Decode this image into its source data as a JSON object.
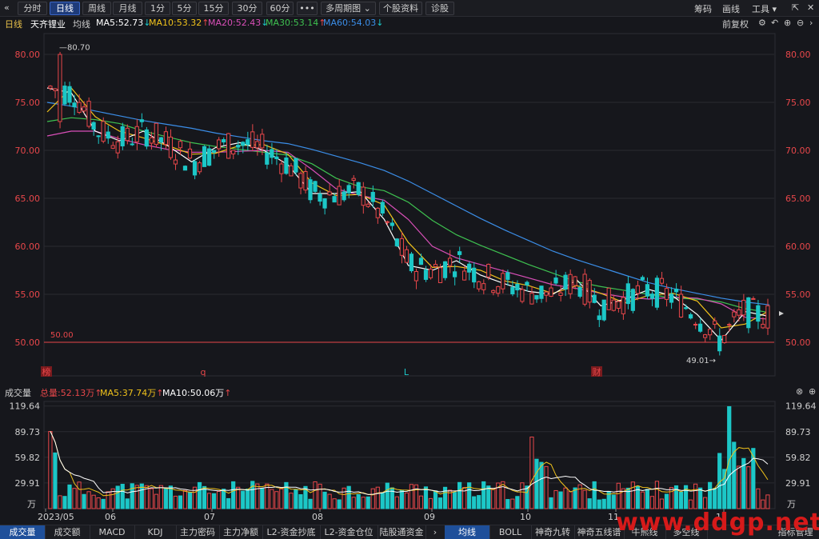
{
  "toolbar": {
    "collapse_icon": "double-chevron-left",
    "tabs": [
      "分时",
      "日线",
      "周线",
      "月线",
      "1分",
      "5分",
      "15分",
      "30分",
      "60分",
      "•••",
      "多周期图 ⌄",
      "个股资料",
      "诊股"
    ],
    "active_tab": "日线",
    "right_items": [
      "筹码",
      "画线",
      "工具 ▾"
    ],
    "window_icons": [
      "pin-icon",
      "close-icon"
    ]
  },
  "ma_bar": {
    "period": "日线",
    "stock_name": "天齐锂业",
    "line_type": "均线",
    "ma5": "MA5:52.73",
    "ma10": "MA10:53.32",
    "ma20": "MA20:52.43",
    "ma30": "MA30:53.14",
    "ma60": "MA60:54.03",
    "adjust": "前复权"
  },
  "colors": {
    "up": "#e8474a",
    "down": "#1cc7c7",
    "ma5": "#ffffff",
    "ma10": "#f0c21b",
    "ma20": "#d94fb8",
    "ma30": "#3ec150",
    "ma60": "#3b8ee8",
    "price_axis": "#e8474a"
  },
  "chart_data": {
    "type": "candlestick",
    "y_ticks": [
      "80.00",
      "75.00",
      "70.00",
      "65.00",
      "60.00",
      "55.00",
      "50.00"
    ],
    "ylim": [
      46.5,
      81.5
    ],
    "high_label": "80.70",
    "low_label": "49.01→",
    "ref_line_label": "50.00",
    "ref_line_value": 50.0,
    "event_markers": [
      "榜",
      "q",
      "L",
      "财"
    ],
    "x_labels": [
      "2023/05",
      "06",
      "07",
      "08",
      "09",
      "10",
      "11",
      "12"
    ],
    "ma60": [
      75.0,
      74.6,
      74.1,
      73.6,
      73.1,
      72.7,
      72.3,
      71.8,
      71.4,
      71.0,
      70.7,
      70.1,
      69.4,
      68.7,
      67.9,
      66.8,
      65.5,
      64.2,
      62.9,
      61.7,
      60.6,
      59.5,
      58.6,
      57.8,
      57.0,
      56.2,
      55.6,
      55.1,
      54.6,
      54.2,
      53.9
    ],
    "ma30": [
      73.0,
      73.4,
      73.2,
      72.8,
      72.0,
      71.4,
      70.8,
      70.4,
      70.1,
      69.8,
      69.5,
      68.6,
      67.1,
      66.2,
      65.8,
      64.6,
      62.7,
      61.2,
      60.1,
      59.1,
      58.1,
      57.2,
      56.3,
      55.8,
      55.4,
      55.0,
      54.6,
      54.5,
      54.2,
      53.5,
      53.1
    ],
    "ma20": [
      71.5,
      72.0,
      72.0,
      71.2,
      70.6,
      70.1,
      69.8,
      69.8,
      69.9,
      70.0,
      69.8,
      68.0,
      66.0,
      65.3,
      64.8,
      62.8,
      60.0,
      58.8,
      58.1,
      57.4,
      56.7,
      56.0,
      55.6,
      55.1,
      54.7,
      54.5,
      54.7,
      54.6,
      54.0,
      52.6,
      52.4
    ],
    "ma10": [
      74.0,
      76.5,
      73.5,
      72.0,
      71.3,
      70.5,
      69.6,
      69.7,
      70.5,
      70.6,
      69.6,
      66.6,
      65.3,
      65.4,
      64.3,
      60.4,
      57.8,
      57.9,
      57.5,
      56.4,
      55.9,
      55.1,
      55.9,
      55.1,
      54.1,
      54.9,
      55.1,
      54.3,
      51.5,
      51.9,
      53.3
    ],
    "ma5": [
      76.5,
      76.0,
      72.0,
      71.0,
      72.0,
      70.5,
      68.8,
      70.3,
      70.8,
      70.0,
      68.5,
      65.5,
      65.5,
      65.7,
      62.8,
      58.0,
      57.5,
      58.5,
      57.0,
      56.1,
      55.3,
      55.0,
      56.5,
      53.8,
      54.5,
      55.5,
      54.8,
      52.9,
      50.2,
      53.2,
      52.7
    ],
    "volume": {
      "label": "成交量",
      "total": "总量:52.13万",
      "ma5": "MA5:37.74万",
      "ma10": "MA10:50.06万",
      "y_ticks": [
        "119.64",
        "89.73",
        "59.82",
        "29.91"
      ],
      "unit": "万",
      "ylim": [
        0,
        125
      ]
    }
  },
  "bottom_tabs": [
    "成交量",
    "成交额",
    "MACD",
    "KDJ",
    "主力密码",
    "主力净额",
    "L2-资金抄底",
    "L2-资金仓位",
    "陆股通资金",
    "›",
    "均线",
    "BOLL",
    "神奇九转",
    "神奇五线谱",
    "牛熊线",
    "多空线"
  ],
  "bottom_active": [
    "成交量",
    "均线"
  ],
  "bottom_right": "指标管理",
  "watermark": "www.ddgp.net"
}
